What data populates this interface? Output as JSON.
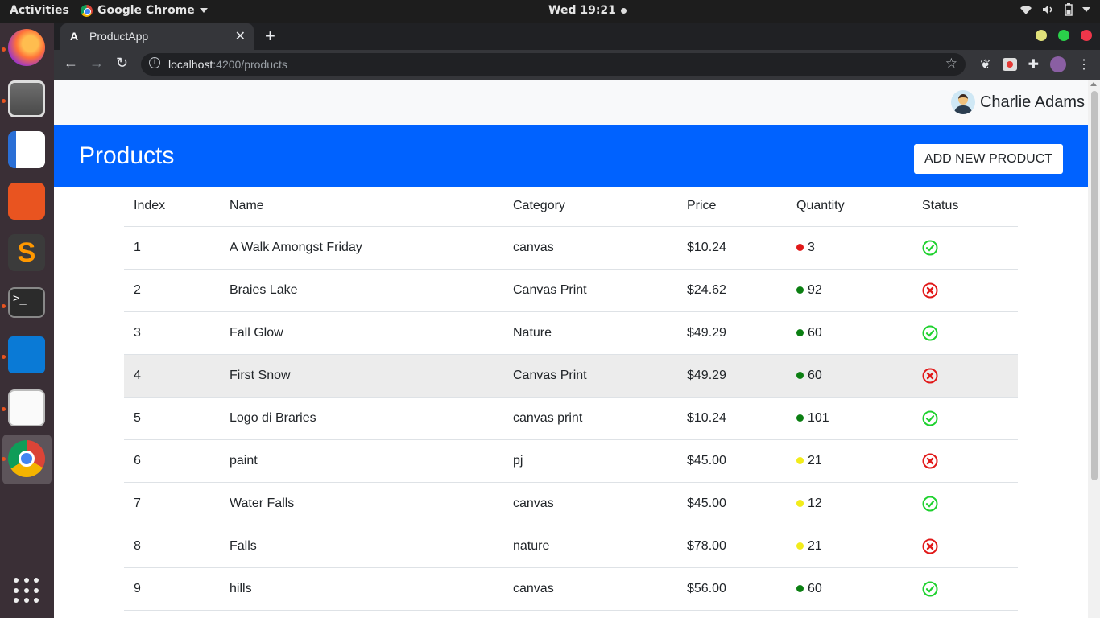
{
  "system": {
    "activities": "Activities",
    "app_name": "Google Chrome",
    "clock": "Wed 19:21"
  },
  "browser": {
    "tab_title": "ProductApp",
    "tab_favicon": "A",
    "url_host": "localhost",
    "url_rest": ":4200/products"
  },
  "header": {
    "user_name": "Charlie Adams"
  },
  "hero": {
    "title": "Products",
    "add_button_label": "ADD NEW PRODUCT"
  },
  "table": {
    "columns": [
      "Index",
      "Name",
      "Category",
      "Price",
      "Quantity",
      "Status"
    ],
    "rows": [
      {
        "index": "1",
        "name": "A Walk Amongst Friday",
        "category": "canvas",
        "price": "$10.24",
        "quantity": "3",
        "qty_color": "#e11919",
        "status": "active"
      },
      {
        "index": "2",
        "name": "Braies Lake",
        "category": "Canvas Print",
        "price": "$24.62",
        "quantity": "92",
        "qty_color": "#0b7f12",
        "status": "inactive"
      },
      {
        "index": "3",
        "name": "Fall Glow",
        "category": "Nature",
        "price": "$49.29",
        "quantity": "60",
        "qty_color": "#0b7f12",
        "status": "active"
      },
      {
        "index": "4",
        "name": "First Snow",
        "category": "Canvas Print",
        "price": "$49.29",
        "quantity": "60",
        "qty_color": "#0b7f12",
        "status": "inactive"
      },
      {
        "index": "5",
        "name": "Logo di Braries",
        "category": "canvas print",
        "price": "$10.24",
        "quantity": "101",
        "qty_color": "#0b7f12",
        "status": "active"
      },
      {
        "index": "6",
        "name": "paint",
        "category": "pj",
        "price": "$45.00",
        "quantity": "21",
        "qty_color": "#f2ec1a",
        "status": "inactive"
      },
      {
        "index": "7",
        "name": "Water Falls",
        "category": "canvas",
        "price": "$45.00",
        "quantity": "12",
        "qty_color": "#f2ec1a",
        "status": "active"
      },
      {
        "index": "8",
        "name": "Falls",
        "category": "nature",
        "price": "$78.00",
        "quantity": "21",
        "qty_color": "#f2ec1a",
        "status": "inactive"
      },
      {
        "index": "9",
        "name": "hills",
        "category": "canvas",
        "price": "$56.00",
        "quantity": "60",
        "qty_color": "#0b7f12",
        "status": "active"
      }
    ],
    "highlighted_row": 3
  },
  "colors": {
    "hero_bg": "#0062ff",
    "status_active": "#1ed12e",
    "status_inactive": "#e11919"
  }
}
